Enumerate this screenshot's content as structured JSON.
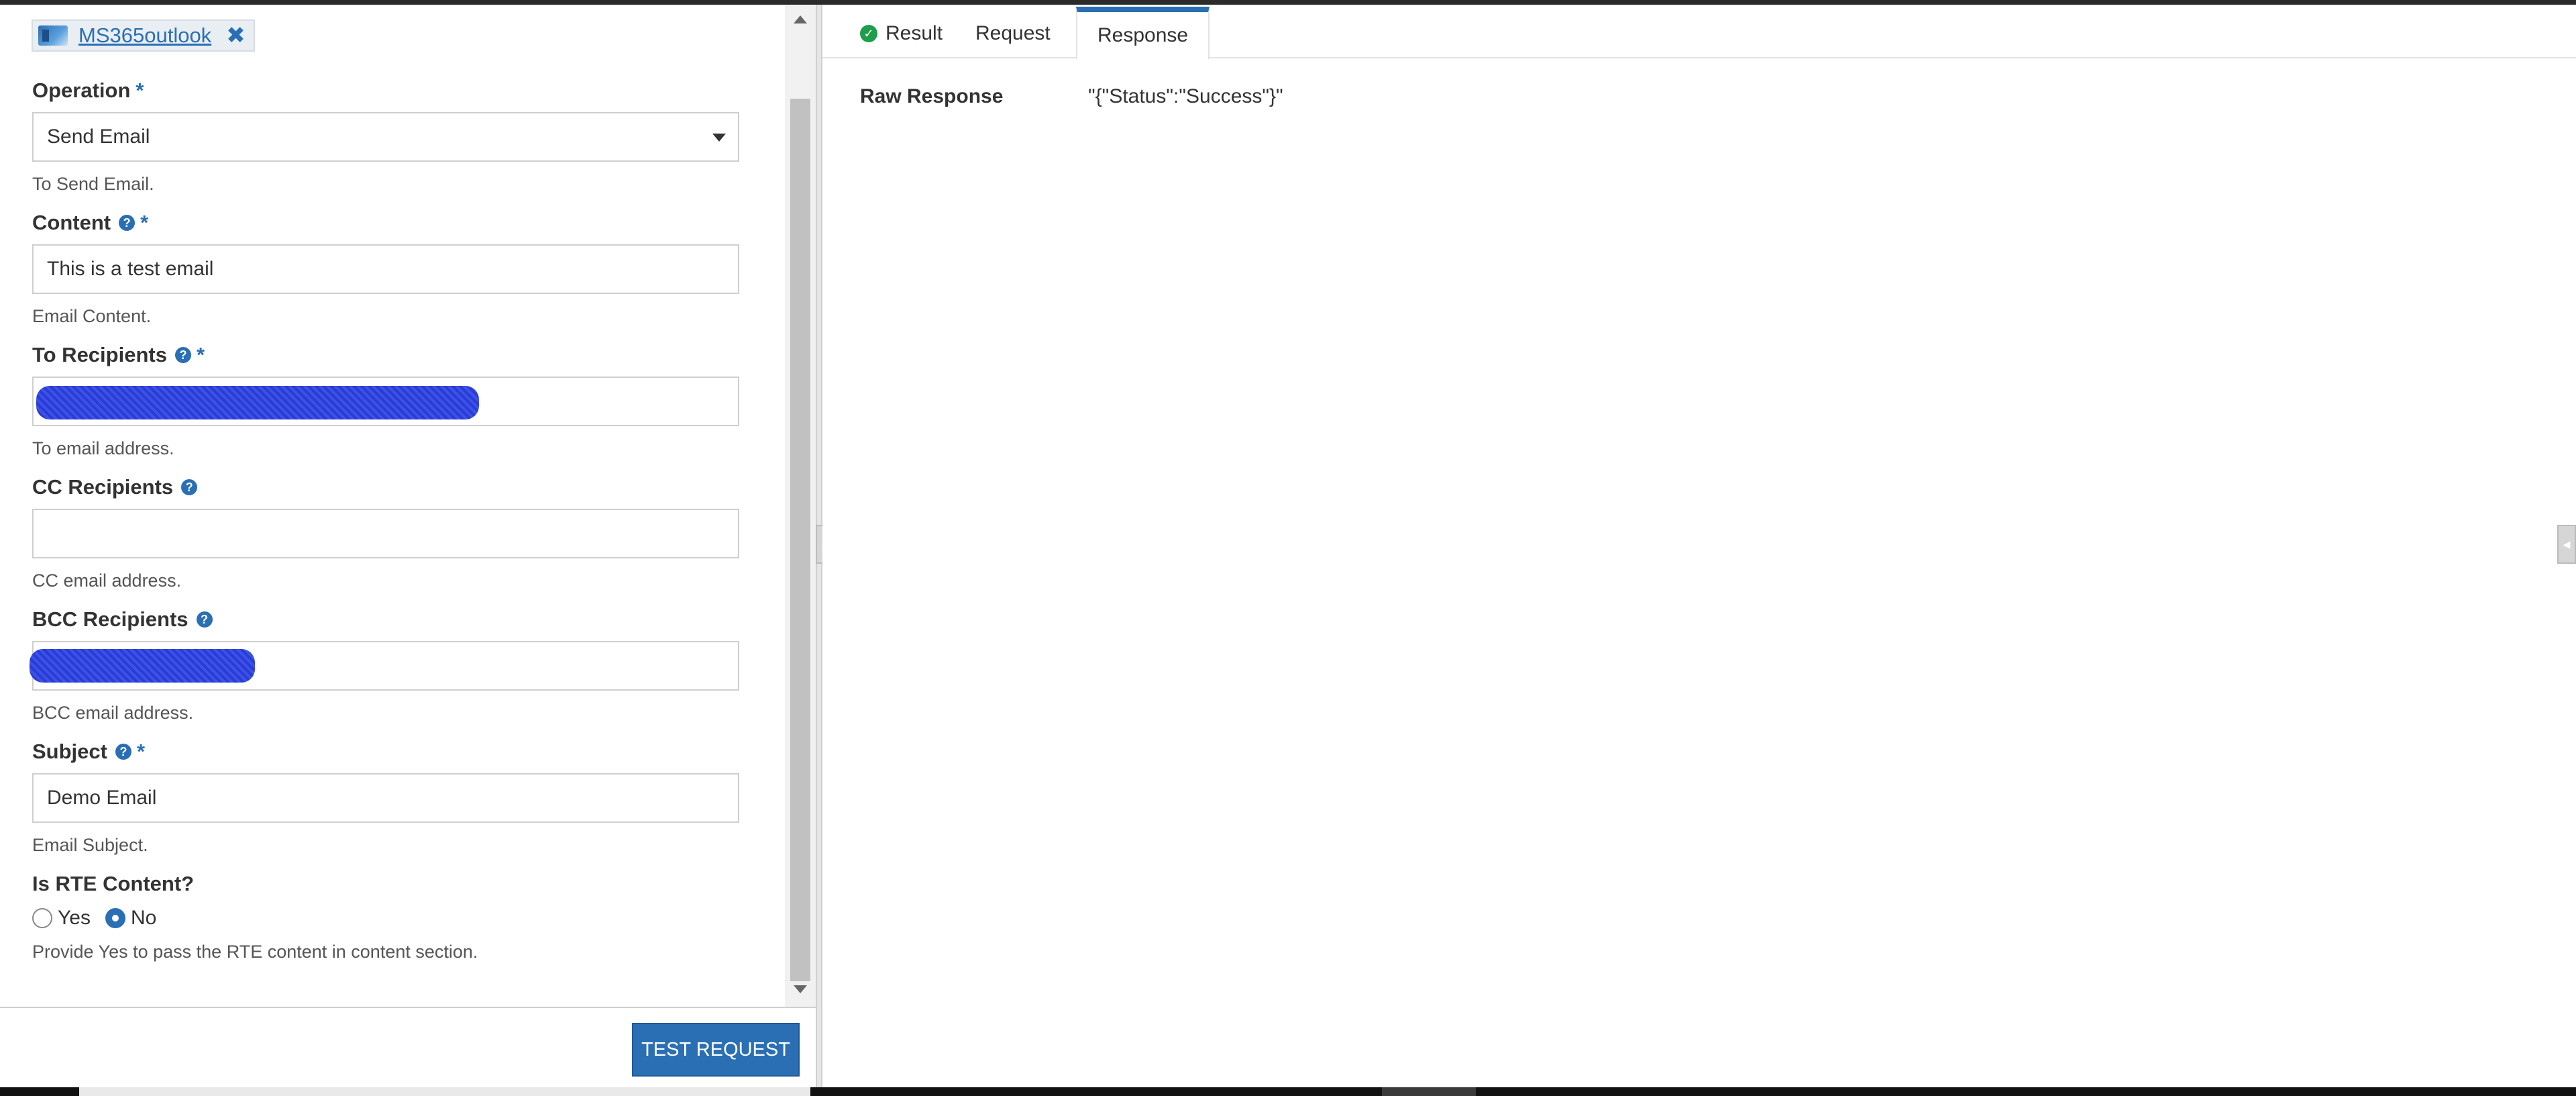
{
  "connection": {
    "name": "MS365outlook",
    "remove_symbol": "✖"
  },
  "form": {
    "operation": {
      "label": "Operation",
      "required": "*",
      "value": "Send Email",
      "hint": "To Send Email."
    },
    "content": {
      "label": "Content",
      "required": "*",
      "value": "This is a test email",
      "hint": "Email Content."
    },
    "to_recipients": {
      "label": "To Recipients",
      "required": "*",
      "value": "",
      "hint": "To email address."
    },
    "cc_recipients": {
      "label": "CC Recipients",
      "value": "",
      "hint": "CC email address."
    },
    "bcc_recipients": {
      "label": "BCC Recipients",
      "value": "",
      "hint": "BCC email address."
    },
    "subject": {
      "label": "Subject",
      "required": "*",
      "value": "Demo Email",
      "hint": "Email Subject."
    },
    "is_rte": {
      "label": "Is RTE Content?",
      "options": [
        "Yes",
        "No"
      ],
      "selected": "No",
      "hint": "Provide Yes to pass the RTE content in content section."
    }
  },
  "footer": {
    "test_button": "TEST REQUEST"
  },
  "tabs": [
    {
      "label": "Result",
      "icon": "check-circle-icon"
    },
    {
      "label": "Request"
    },
    {
      "label": "Response",
      "active": true
    }
  ],
  "response": {
    "label": "Raw Response",
    "value": "\"{\"Status\":\"Success\"}\""
  },
  "colors": {
    "accent": "#2a6fb4",
    "success": "#1e9e4a"
  }
}
